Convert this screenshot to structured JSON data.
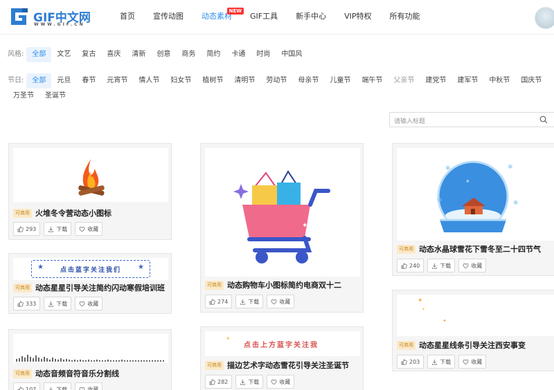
{
  "header": {
    "logo_text": "GIF中文网",
    "logo_sub": "WWW.GIF.CN",
    "nav": [
      {
        "label": "首页"
      },
      {
        "label": "宣传动图"
      },
      {
        "label": "动态素材",
        "badge": "NEW"
      },
      {
        "label": "GIF工具"
      },
      {
        "label": "新手中心"
      },
      {
        "label": "VIP特权"
      },
      {
        "label": "所有功能"
      }
    ]
  },
  "filters": {
    "style_label": "风格:",
    "style_options": [
      "全部",
      "文艺",
      "复古",
      "喜庆",
      "清新",
      "创意",
      "商务",
      "简约",
      "卡通",
      "时尚",
      "中国风"
    ],
    "holiday_label": "节日:",
    "holiday_options": [
      "全部",
      "元旦",
      "春节",
      "元宵节",
      "情人节",
      "妇女节",
      "植树节",
      "清明节",
      "劳动节",
      "母亲节",
      "儿童节",
      "端午节",
      "父亲节",
      "建党节",
      "建军节",
      "中秋节",
      "国庆节",
      "万圣节",
      "圣诞节"
    ]
  },
  "search": {
    "placeholder": "请输入标题"
  },
  "actions": {
    "download": "下载",
    "collect": "收藏"
  },
  "cards": [
    {
      "tag": "可商用",
      "title": "火堆冬令营动态小图标",
      "likes": "293"
    },
    {
      "tag": "可商用",
      "title": "动态星星引导关注简约闪动寒假培训班",
      "likes": "333",
      "banner_text": "点击蓝字关注我们"
    },
    {
      "tag": "可商用",
      "title": "动态音频音符音乐分割线",
      "likes": "107"
    },
    {
      "tag": "可商用",
      "title": "动态购物车小图标简约电商双十二",
      "likes": "274"
    },
    {
      "tag": "可商用",
      "title": "描边艺术字动态雪花引导关注圣诞节",
      "likes": "282",
      "banner_text": "点击上方蓝字关注我"
    },
    {
      "tag": "可商用",
      "title": "动态水晶球雪花下雪冬至二十四节气",
      "likes": "240"
    },
    {
      "tag": "可商用",
      "title": "动态星星线条引导关注西安事变",
      "likes": "203"
    }
  ],
  "colors": {
    "accent": "#2d8cf0",
    "tag_bg": "#fbe9c9",
    "tag_text": "#c88a1e"
  }
}
